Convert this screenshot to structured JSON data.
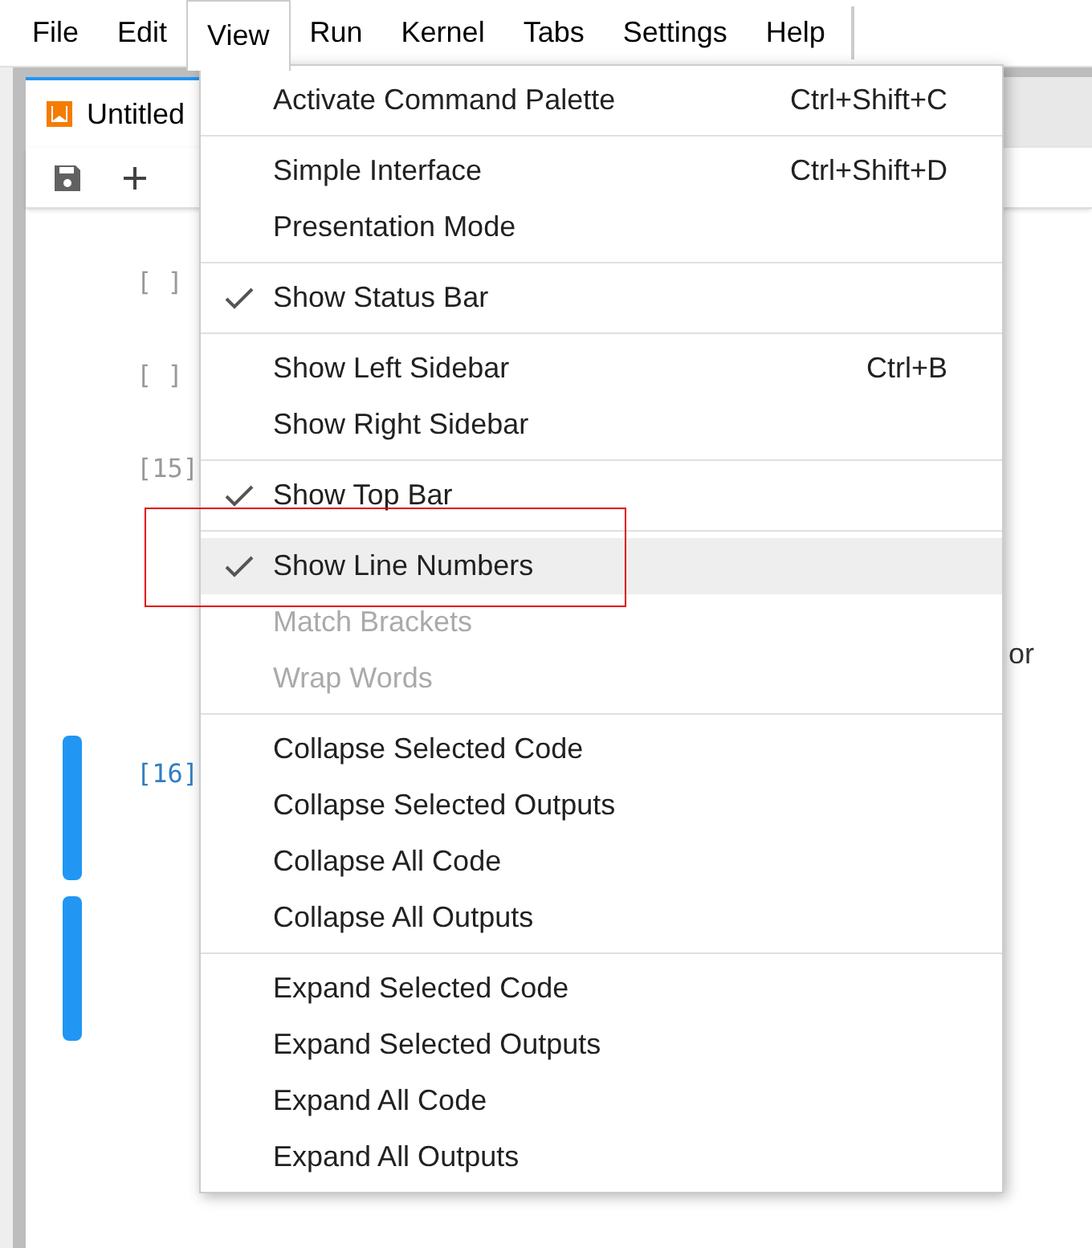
{
  "menubar": [
    {
      "label": "File",
      "selected": false
    },
    {
      "label": "Edit",
      "selected": false
    },
    {
      "label": "View",
      "selected": true
    },
    {
      "label": "Run",
      "selected": false
    },
    {
      "label": "Kernel",
      "selected": false
    },
    {
      "label": "Tabs",
      "selected": false
    },
    {
      "label": "Settings",
      "selected": false
    },
    {
      "label": "Help",
      "selected": false
    }
  ],
  "tab": {
    "label": "Untitled"
  },
  "cells": [
    {
      "prompt": "[ ]",
      "active": false
    },
    {
      "prompt": "[ ]",
      "active": false
    },
    {
      "prompt": "[15]",
      "active": false
    },
    {
      "prompt": "[16]",
      "active": true
    },
    {
      "active": true
    }
  ],
  "output_fragment": "or",
  "view_menu": {
    "sections": [
      [
        {
          "label": "Activate Command Palette",
          "shortcut": "Ctrl+Shift+C",
          "checked": false,
          "disabled": false,
          "selected": false
        }
      ],
      [
        {
          "label": "Simple Interface",
          "shortcut": "Ctrl+Shift+D",
          "checked": false,
          "disabled": false,
          "selected": false
        },
        {
          "label": "Presentation Mode",
          "checked": false,
          "disabled": false,
          "selected": false
        }
      ],
      [
        {
          "label": "Show Status Bar",
          "checked": true,
          "disabled": false,
          "selected": false
        }
      ],
      [
        {
          "label": "Show Left Sidebar",
          "shortcut": "Ctrl+B",
          "checked": false,
          "disabled": false,
          "selected": false
        },
        {
          "label": "Show Right Sidebar",
          "checked": false,
          "disabled": false,
          "selected": false
        }
      ],
      [
        {
          "label": "Show Top Bar",
          "checked": true,
          "disabled": false,
          "selected": false
        }
      ],
      [
        {
          "label": "Show Line Numbers",
          "checked": true,
          "disabled": false,
          "selected": true
        },
        {
          "label": "Match Brackets",
          "checked": false,
          "disabled": true,
          "selected": false
        },
        {
          "label": "Wrap Words",
          "checked": false,
          "disabled": true,
          "selected": false
        }
      ],
      [
        {
          "label": "Collapse Selected Code",
          "checked": false,
          "disabled": false,
          "selected": false
        },
        {
          "label": "Collapse Selected Outputs",
          "checked": false,
          "disabled": false,
          "selected": false
        },
        {
          "label": "Collapse All Code",
          "checked": false,
          "disabled": false,
          "selected": false
        },
        {
          "label": "Collapse All Outputs",
          "checked": false,
          "disabled": false,
          "selected": false
        }
      ],
      [
        {
          "label": "Expand Selected Code",
          "checked": false,
          "disabled": false,
          "selected": false
        },
        {
          "label": "Expand Selected Outputs",
          "checked": false,
          "disabled": false,
          "selected": false
        },
        {
          "label": "Expand All Code",
          "checked": false,
          "disabled": false,
          "selected": false
        },
        {
          "label": "Expand All Outputs",
          "checked": false,
          "disabled": false,
          "selected": false
        }
      ]
    ]
  }
}
